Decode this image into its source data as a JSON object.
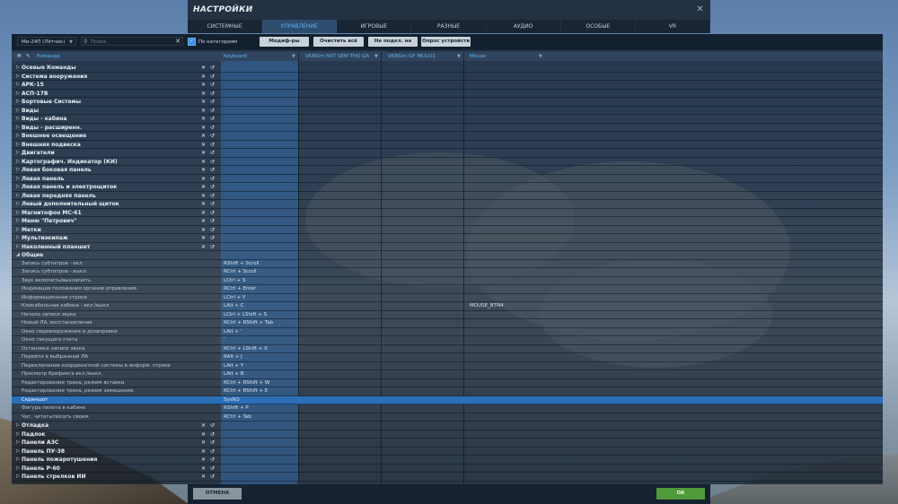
{
  "window": {
    "title": "НАСТРОЙКИ",
    "close_symbol": "✕"
  },
  "tabs": [
    "СИСТЕМНЫЕ",
    "УПРАВЛЕНИЕ",
    "ИГРОВЫЕ",
    "РАЗНЫЕ",
    "АУДИО",
    "ОСОБЫЕ",
    "VR"
  ],
  "active_tab": "УПРАВЛЕНИЕ",
  "toolbar": {
    "aircraft": "Ми-24П (Лётчик)",
    "search_placeholder": "Поиск",
    "by_categories": "По категориям",
    "modifiers": "Модиф-ры",
    "clear_all": "Очистить всё",
    "not_connected": "Не подкл. на лету",
    "poll_devices": "Опрос устройств"
  },
  "columns": {
    "command": "Команда",
    "keyboard": "Keyboard",
    "vkb_thq": "VKBSim NXT SEM THQ GA",
    "vkb_gf": "VKBSim GF MCGU1",
    "mouse": "Mouse"
  },
  "rows": [
    {
      "type": "cat",
      "name": "Осевые Команды"
    },
    {
      "type": "cat",
      "name": "Система вооружения"
    },
    {
      "type": "cat",
      "name": "АРК-15"
    },
    {
      "type": "cat",
      "name": "АСП-17В"
    },
    {
      "type": "cat",
      "name": "Бортовые Системы"
    },
    {
      "type": "cat",
      "name": "Виды"
    },
    {
      "type": "cat",
      "name": "Виды - кабина"
    },
    {
      "type": "cat",
      "name": "Виды - расширенн."
    },
    {
      "type": "cat",
      "name": "Внешнее освещение"
    },
    {
      "type": "cat",
      "name": "Внешняя подвеска"
    },
    {
      "type": "cat",
      "name": "Двигатели"
    },
    {
      "type": "cat",
      "name": "Картографич. Индикатор (КИ)"
    },
    {
      "type": "cat",
      "name": "Левая боковая панель"
    },
    {
      "type": "cat",
      "name": "Левая панель"
    },
    {
      "type": "cat",
      "name": "Левая панель и электрощиток"
    },
    {
      "type": "cat",
      "name": "Левая передняя панель"
    },
    {
      "type": "cat",
      "name": "Левый дополнительный щиток"
    },
    {
      "type": "cat",
      "name": "Магнитофон МС-61"
    },
    {
      "type": "cat",
      "name": "Меню \"Петрович\""
    },
    {
      "type": "cat",
      "name": "Метки"
    },
    {
      "type": "cat",
      "name": "Мультиэкипаж"
    },
    {
      "type": "cat",
      "name": "Наколенный планшет"
    },
    {
      "type": "cat",
      "name": "Общие",
      "expanded": true
    },
    {
      "type": "item",
      "name": "Запись субтитров - вкл.",
      "keyboard": "RShift + Scroll"
    },
    {
      "type": "item",
      "name": "Запись субтитров - выкл.",
      "keyboard": "RCtrl + Scroll"
    },
    {
      "type": "item",
      "name": "Звук включить/выключить",
      "keyboard": "LCtrl + S"
    },
    {
      "type": "item",
      "name": "Индикация положения органов управления",
      "keyboard": "RCtrl + Enter"
    },
    {
      "type": "item",
      "name": "Информационная строка",
      "keyboard": "LCtrl + Y"
    },
    {
      "type": "item",
      "name": "Кликабельная кабина - вкл./выкл",
      "keyboard": "LAlt + C",
      "mouse": "MOUSE_BTN4"
    },
    {
      "type": "item",
      "name": "Начало записи звука",
      "keyboard": "LCtrl + LShift + S"
    },
    {
      "type": "item",
      "name": "Новый ЛА, восстановление",
      "keyboard": "RCtrl + RShift + Tab"
    },
    {
      "type": "item",
      "name": "Окно перевооружения и дозаправки",
      "keyboard": "LAlt + '"
    },
    {
      "type": "item",
      "name": "Окно текущего счета",
      "keyboard": "'"
    },
    {
      "type": "item",
      "name": "Остановка записи звука",
      "keyboard": "RCtrl + LShift + X"
    },
    {
      "type": "item",
      "name": "Перейти в выбранный ЛА",
      "keyboard": "RAlt + J"
    },
    {
      "type": "item",
      "name": "Переключение координатной системы в информ. строке",
      "keyboard": "LAlt + Y"
    },
    {
      "type": "item",
      "name": "Просмотр брифинга вкл./выкл.",
      "keyboard": "LAlt + B"
    },
    {
      "type": "item",
      "name": "Редактирование трека, режим вставки.",
      "keyboard": "RCtrl + RShift + W"
    },
    {
      "type": "item",
      "name": "Редактирование трека, режим замещения.",
      "keyboard": "RCtrl + RShift + E"
    },
    {
      "type": "item",
      "name": "Скриншот",
      "keyboard": "SysRQ",
      "selected": true
    },
    {
      "type": "item",
      "name": "Фигура пилота в кабине",
      "keyboard": "RShift + P"
    },
    {
      "type": "item",
      "name": "Чат, читать/писать своим",
      "keyboard": "RCtrl + Tab"
    },
    {
      "type": "cat",
      "name": "Отладка"
    },
    {
      "type": "cat",
      "name": "Падлок"
    },
    {
      "type": "cat",
      "name": "Панели АЗС"
    },
    {
      "type": "cat",
      "name": "Панель ПУ-38"
    },
    {
      "type": "cat",
      "name": "Панель пожаротушения"
    },
    {
      "type": "cat",
      "name": "Панель Р-60"
    },
    {
      "type": "cat",
      "name": "Панель стрелков ИИ"
    }
  ],
  "footer": {
    "cancel": "ОТМЕНА",
    "ok": "OK"
  },
  "colors": {
    "accent": "#5fb4ff",
    "selected_row": "#2c6fb8",
    "ok_button": "#4f9a3a"
  }
}
